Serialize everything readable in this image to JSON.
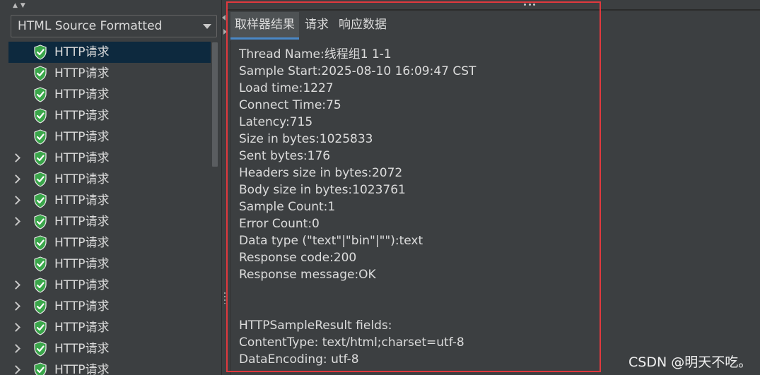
{
  "renderer": {
    "selected": "HTML Source Formatted"
  },
  "tree": {
    "items": [
      {
        "label": "HTTP请求",
        "expandable": false,
        "selected": true
      },
      {
        "label": "HTTP请求",
        "expandable": false,
        "selected": false
      },
      {
        "label": "HTTP请求",
        "expandable": false,
        "selected": false
      },
      {
        "label": "HTTP请求",
        "expandable": false,
        "selected": false
      },
      {
        "label": "HTTP请求",
        "expandable": false,
        "selected": false
      },
      {
        "label": "HTTP请求",
        "expandable": true,
        "selected": false
      },
      {
        "label": "HTTP请求",
        "expandable": true,
        "selected": false
      },
      {
        "label": "HTTP请求",
        "expandable": true,
        "selected": false
      },
      {
        "label": "HTTP请求",
        "expandable": true,
        "selected": false
      },
      {
        "label": "HTTP请求",
        "expandable": false,
        "selected": false
      },
      {
        "label": "HTTP请求",
        "expandable": false,
        "selected": false
      },
      {
        "label": "HTTP请求",
        "expandable": true,
        "selected": false
      },
      {
        "label": "HTTP请求",
        "expandable": true,
        "selected": false
      },
      {
        "label": "HTTP请求",
        "expandable": true,
        "selected": false
      },
      {
        "label": "HTTP请求",
        "expandable": true,
        "selected": false
      },
      {
        "label": "HTTP请求",
        "expandable": true,
        "selected": false
      }
    ]
  },
  "tabs": [
    {
      "label": "取样器结果",
      "active": true
    },
    {
      "label": "请求",
      "active": false
    },
    {
      "label": "响应数据",
      "active": false
    }
  ],
  "result": {
    "lines": [
      "Thread Name:线程组1 1-1",
      "Sample Start:2025-08-10 16:09:47 CST",
      "Load time:1227",
      "Connect Time:75",
      "Latency:715",
      "Size in bytes:1025833",
      "Sent bytes:176",
      "Headers size in bytes:2072",
      "Body size in bytes:1023761",
      "Sample Count:1",
      "Error Count:0",
      "Data type (\"text\"|\"bin\"|\"\"):text",
      "Response code:200",
      "Response message:OK",
      "",
      "",
      "HTTPSampleResult fields:",
      "ContentType: text/html;charset=utf-8",
      "DataEncoding: utf-8"
    ]
  },
  "watermark": "CSDN @明天不吃。",
  "colors": {
    "background": "#3c3f41",
    "selected_row": "#0d293e",
    "text": "#dcdcdc",
    "shield": "#3aa64a",
    "highlight": "#e0393e",
    "tab_underline": "#4a88c7"
  },
  "icons": {
    "tree_item": "shield-check-icon",
    "expand": "chevron-right-icon",
    "dropdown": "caret-down-icon"
  }
}
